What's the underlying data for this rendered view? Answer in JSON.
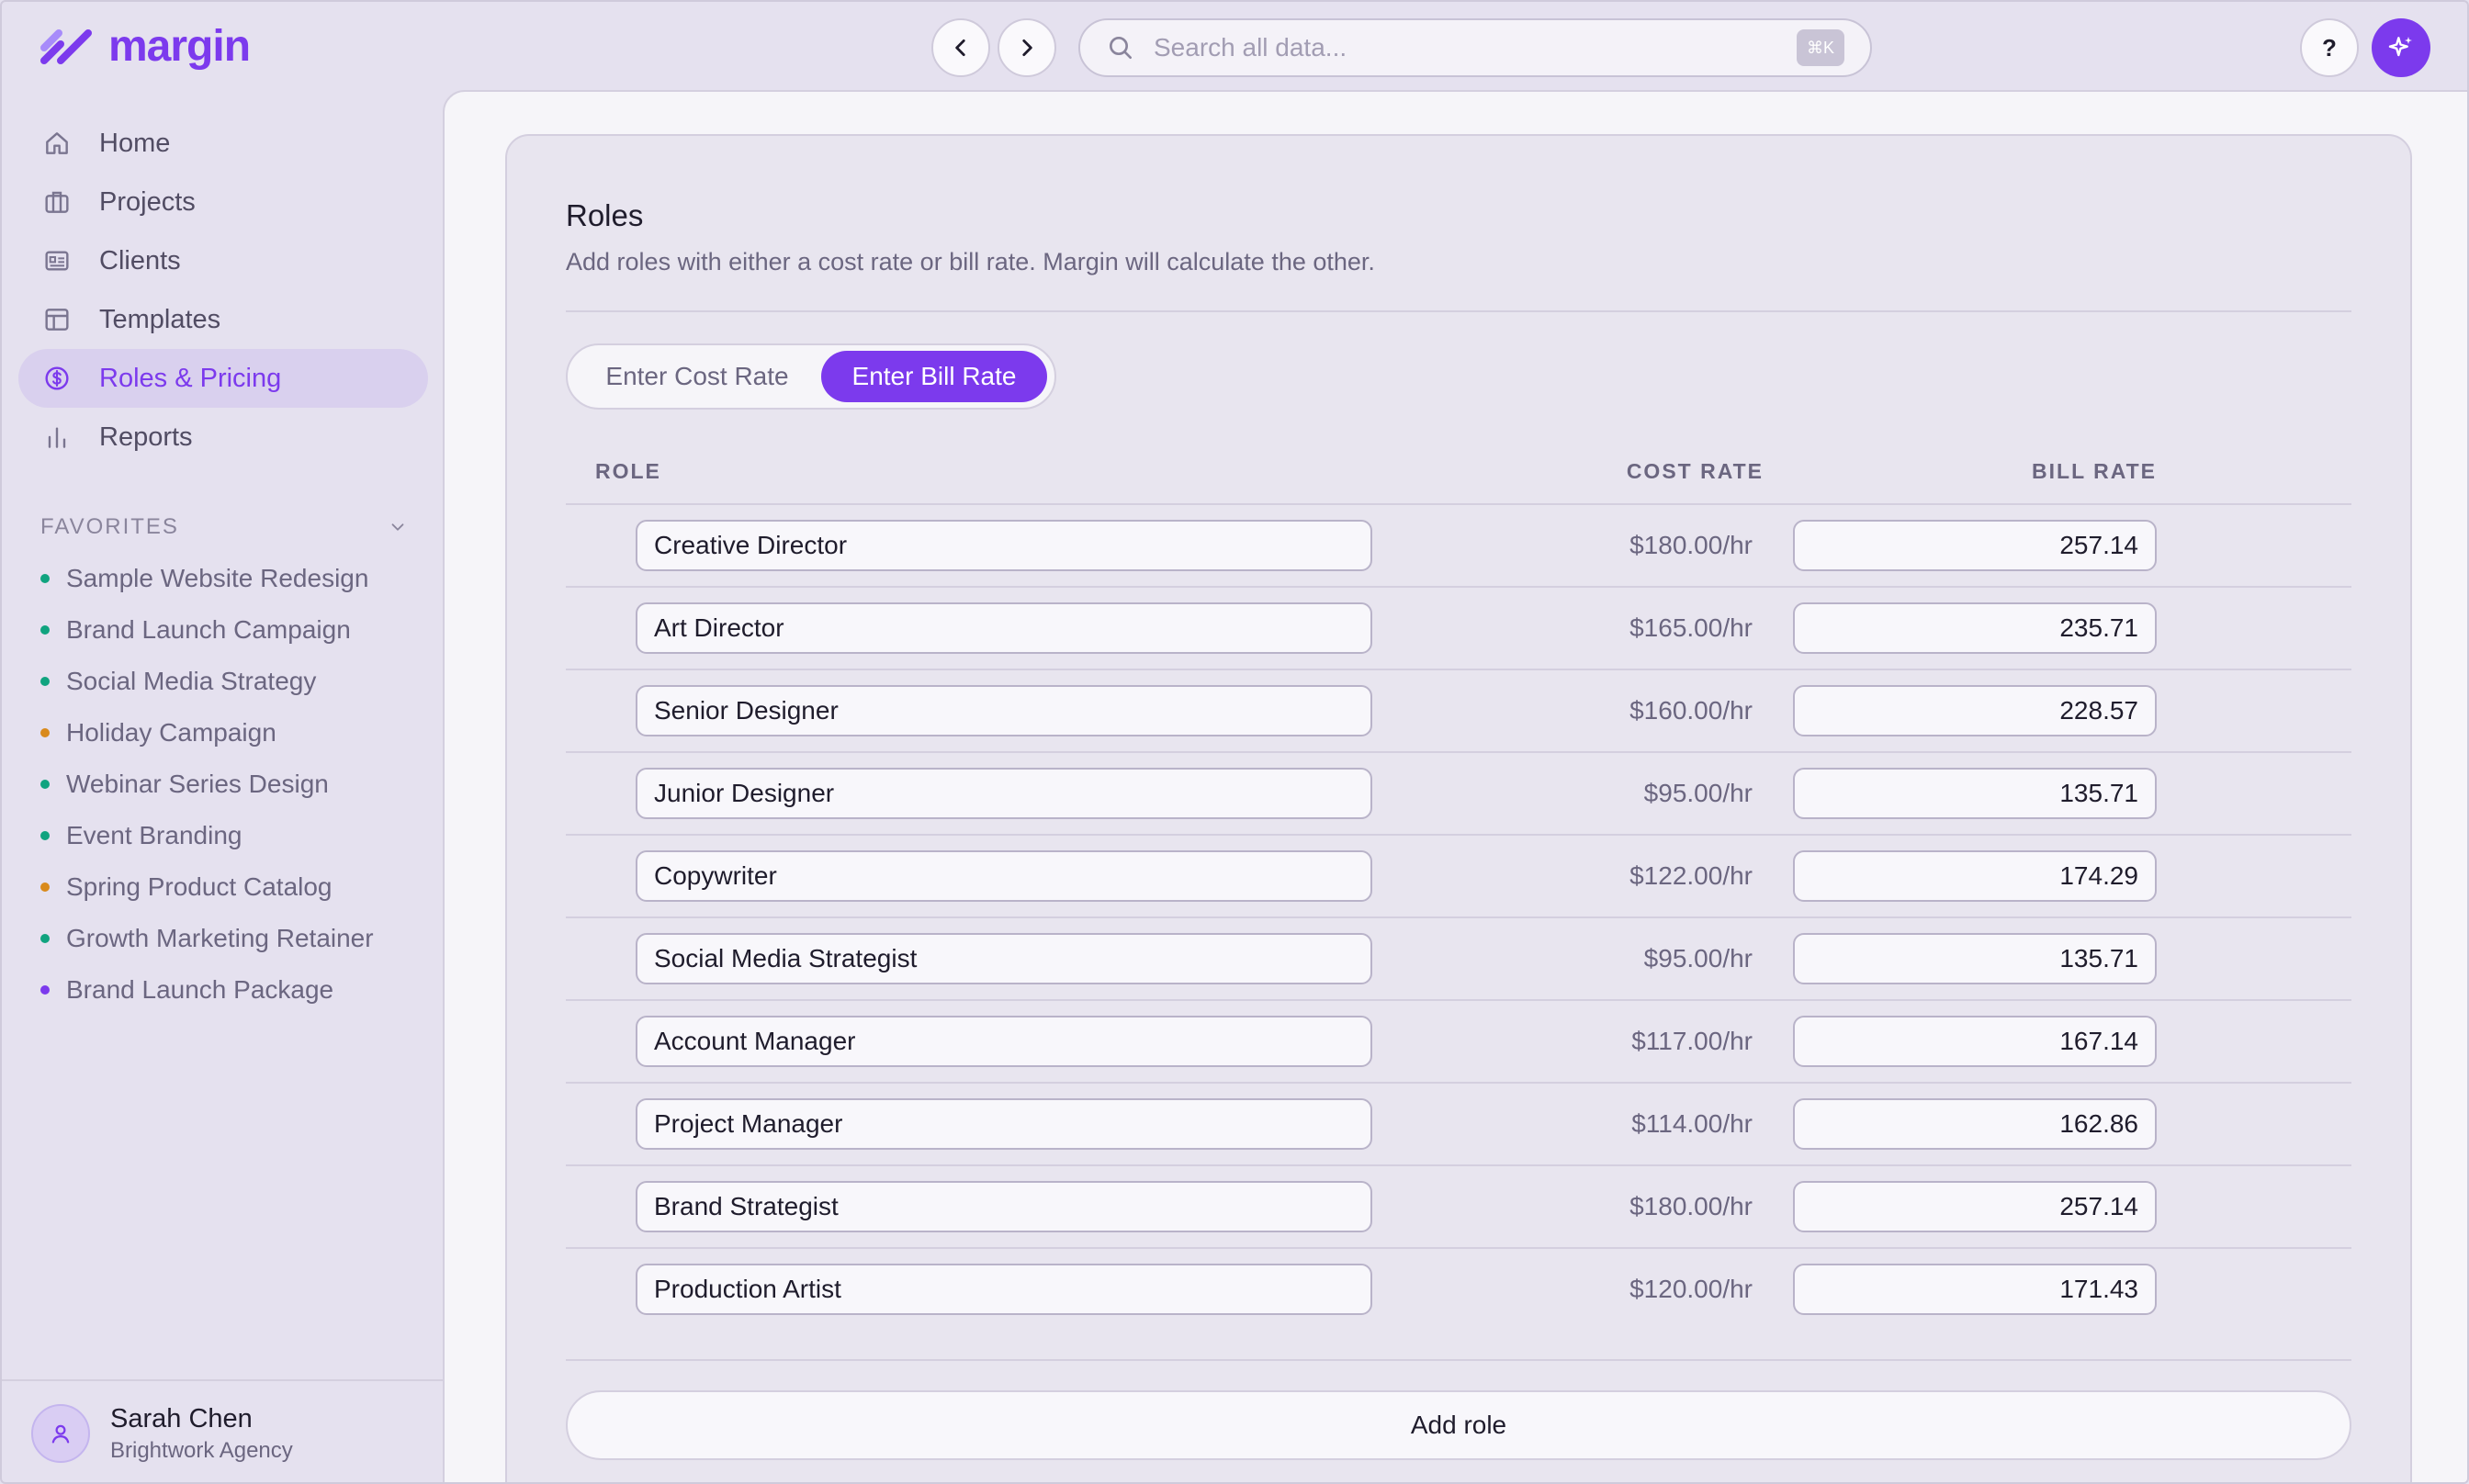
{
  "app": {
    "name": "margin",
    "brand_color": "#7c3aed"
  },
  "search": {
    "placeholder": "Search all data...",
    "shortcut": "⌘K"
  },
  "header": {
    "help_label": "?"
  },
  "sidebar": {
    "items": [
      {
        "label": "Home",
        "icon": "home-icon"
      },
      {
        "label": "Projects",
        "icon": "briefcase-icon"
      },
      {
        "label": "Clients",
        "icon": "id-card-icon"
      },
      {
        "label": "Templates",
        "icon": "layout-icon"
      },
      {
        "label": "Roles & Pricing",
        "icon": "dollar-circle-icon",
        "active": true
      },
      {
        "label": "Reports",
        "icon": "bar-chart-icon"
      }
    ],
    "favorites_label": "FAVORITES",
    "favorites": [
      {
        "label": "Sample Website Redesign",
        "color": "#10a37f"
      },
      {
        "label": "Brand Launch Campaign",
        "color": "#10a37f"
      },
      {
        "label": "Social Media Strategy",
        "color": "#10a37f"
      },
      {
        "label": "Holiday Campaign",
        "color": "#d98a1c"
      },
      {
        "label": "Webinar Series Design",
        "color": "#10a37f"
      },
      {
        "label": "Event Branding",
        "color": "#10a37f"
      },
      {
        "label": "Spring Product Catalog",
        "color": "#d98a1c"
      },
      {
        "label": "Growth Marketing Retainer",
        "color": "#10a37f"
      },
      {
        "label": "Brand Launch Package",
        "color": "#7c3aed"
      }
    ]
  },
  "user": {
    "name": "Sarah Chen",
    "org": "Brightwork Agency"
  },
  "roles": {
    "title": "Roles",
    "subtitle": "Add roles with either a cost rate or bill rate. Margin will calculate the other.",
    "toggle": {
      "cost_label": "Enter Cost Rate",
      "bill_label": "Enter Bill Rate",
      "selected": "bill"
    },
    "columns": {
      "role": "ROLE",
      "cost": "COST RATE",
      "bill": "BILL RATE"
    },
    "rows": [
      {
        "role": "Creative Director",
        "cost": "$180.00/hr",
        "bill": "257.14"
      },
      {
        "role": "Art Director",
        "cost": "$165.00/hr",
        "bill": "235.71"
      },
      {
        "role": "Senior Designer",
        "cost": "$160.00/hr",
        "bill": "228.57"
      },
      {
        "role": "Junior Designer",
        "cost": "$95.00/hr",
        "bill": "135.71"
      },
      {
        "role": "Copywriter",
        "cost": "$122.00/hr",
        "bill": "174.29"
      },
      {
        "role": "Social Media Strategist",
        "cost": "$95.00/hr",
        "bill": "135.71"
      },
      {
        "role": "Account Manager",
        "cost": "$117.00/hr",
        "bill": "167.14"
      },
      {
        "role": "Project Manager",
        "cost": "$114.00/hr",
        "bill": "162.86"
      },
      {
        "role": "Brand Strategist",
        "cost": "$180.00/hr",
        "bill": "257.14"
      },
      {
        "role": "Production Artist",
        "cost": "$120.00/hr",
        "bill": "171.43"
      }
    ],
    "add_label": "Add role"
  }
}
